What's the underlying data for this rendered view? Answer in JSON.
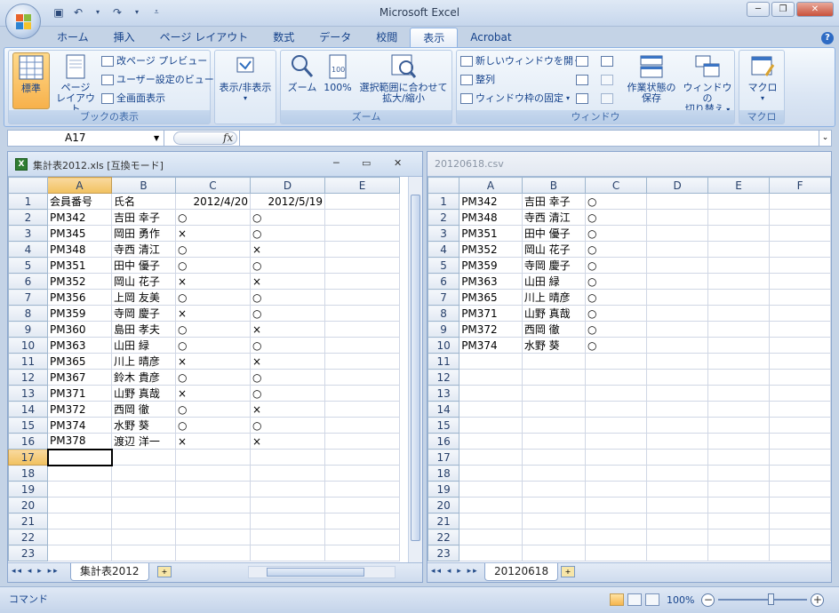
{
  "app": {
    "title": "Microsoft Excel"
  },
  "ribbon": {
    "tabs": [
      "ホーム",
      "挿入",
      "ページ レイアウト",
      "数式",
      "データ",
      "校閲",
      "表示",
      "Acrobat"
    ],
    "active_tab": "表示",
    "groups": {
      "book_view": {
        "label": "ブックの表示",
        "normal": "標準",
        "page_layout_1": "ページ",
        "page_layout_2": "レイアウト",
        "page_break_preview": "改ページ プレビュー",
        "custom_view": "ユーザー設定のビュー",
        "full_screen": "全画面表示"
      },
      "show_hide": {
        "label": "表示/非表示"
      },
      "zoom": {
        "label": "ズーム",
        "zoom": "ズーム",
        "zoom100": "100%",
        "zoom_selection_1": "選択範囲に合わせて",
        "zoom_selection_2": "拡大/縮小"
      },
      "window": {
        "label": "ウィンドウ",
        "new_window": "新しいウィンドウを開く",
        "arrange": "整列",
        "freeze": "ウィンドウ枠の固定",
        "save_workspace_1": "作業状態の",
        "save_workspace_2": "保存",
        "switch_1": "ウィンドウの",
        "switch_2": "切り替え"
      },
      "macro": {
        "label": "マクロ",
        "macro": "マクロ"
      }
    }
  },
  "formula_bar": {
    "name_box": "A17",
    "fx": "fx",
    "formula": ""
  },
  "left_window": {
    "title": "集計表2012.xls  [互換モード]",
    "sheet_tab": "集計表2012",
    "columns": [
      "A",
      "B",
      "C",
      "D",
      "E"
    ],
    "selected_column": "A",
    "selected_row": "17",
    "rows": [
      {
        "n": "1",
        "cells": [
          "会員番号",
          "氏名",
          "2012/4/20",
          "2012/5/19",
          ""
        ]
      },
      {
        "n": "2",
        "cells": [
          "PM342",
          "吉田 幸子",
          "○",
          "○",
          ""
        ]
      },
      {
        "n": "3",
        "cells": [
          "PM345",
          "岡田 勇作",
          "×",
          "○",
          ""
        ]
      },
      {
        "n": "4",
        "cells": [
          "PM348",
          "寺西 清江",
          "○",
          "×",
          ""
        ]
      },
      {
        "n": "5",
        "cells": [
          "PM351",
          "田中 優子",
          "○",
          "○",
          ""
        ]
      },
      {
        "n": "6",
        "cells": [
          "PM352",
          "岡山 花子",
          "×",
          "×",
          ""
        ]
      },
      {
        "n": "7",
        "cells": [
          "PM356",
          "上岡 友美",
          "○",
          "○",
          ""
        ]
      },
      {
        "n": "8",
        "cells": [
          "PM359",
          "寺岡 慶子",
          "×",
          "○",
          ""
        ]
      },
      {
        "n": "9",
        "cells": [
          "PM360",
          "島田 孝夫",
          "○",
          "×",
          ""
        ]
      },
      {
        "n": "10",
        "cells": [
          "PM363",
          "山田 緑",
          "○",
          "○",
          ""
        ]
      },
      {
        "n": "11",
        "cells": [
          "PM365",
          "川上 晴彦",
          "×",
          "×",
          ""
        ]
      },
      {
        "n": "12",
        "cells": [
          "PM367",
          "鈴木 貴彦",
          "○",
          "○",
          ""
        ]
      },
      {
        "n": "13",
        "cells": [
          "PM371",
          "山野 真哉",
          "×",
          "○",
          ""
        ]
      },
      {
        "n": "14",
        "cells": [
          "PM372",
          "西岡 徹",
          "○",
          "×",
          ""
        ]
      },
      {
        "n": "15",
        "cells": [
          "PM374",
          "水野 葵",
          "○",
          "○",
          ""
        ]
      },
      {
        "n": "16",
        "cells": [
          "PM378",
          "渡辺 洋一",
          "×",
          "×",
          ""
        ]
      },
      {
        "n": "17",
        "cells": [
          "",
          "",
          "",
          "",
          ""
        ]
      },
      {
        "n": "18",
        "cells": [
          "",
          "",
          "",
          "",
          ""
        ]
      },
      {
        "n": "19",
        "cells": [
          "",
          "",
          "",
          "",
          ""
        ]
      },
      {
        "n": "20",
        "cells": [
          "",
          "",
          "",
          "",
          ""
        ]
      },
      {
        "n": "21",
        "cells": [
          "",
          "",
          "",
          "",
          ""
        ]
      },
      {
        "n": "22",
        "cells": [
          "",
          "",
          "",
          "",
          ""
        ]
      },
      {
        "n": "23",
        "cells": [
          "",
          "",
          "",
          "",
          ""
        ]
      }
    ]
  },
  "right_window": {
    "title": "20120618.csv",
    "sheet_tab": "20120618",
    "columns": [
      "A",
      "B",
      "C",
      "D",
      "E",
      "F"
    ],
    "rows": [
      {
        "n": "1",
        "cells": [
          "PM342",
          "吉田 幸子",
          "○",
          "",
          "",
          ""
        ]
      },
      {
        "n": "2",
        "cells": [
          "PM348",
          "寺西 清江",
          "○",
          "",
          "",
          ""
        ]
      },
      {
        "n": "3",
        "cells": [
          "PM351",
          "田中 優子",
          "○",
          "",
          "",
          ""
        ]
      },
      {
        "n": "4",
        "cells": [
          "PM352",
          "岡山 花子",
          "○",
          "",
          "",
          ""
        ]
      },
      {
        "n": "5",
        "cells": [
          "PM359",
          "寺岡 慶子",
          "○",
          "",
          "",
          ""
        ]
      },
      {
        "n": "6",
        "cells": [
          "PM363",
          "山田 緑",
          "○",
          "",
          "",
          ""
        ]
      },
      {
        "n": "7",
        "cells": [
          "PM365",
          "川上 晴彦",
          "○",
          "",
          "",
          ""
        ]
      },
      {
        "n": "8",
        "cells": [
          "PM371",
          "山野 真哉",
          "○",
          "",
          "",
          ""
        ]
      },
      {
        "n": "9",
        "cells": [
          "PM372",
          "西岡 徹",
          "○",
          "",
          "",
          ""
        ]
      },
      {
        "n": "10",
        "cells": [
          "PM374",
          "水野 葵",
          "○",
          "",
          "",
          ""
        ]
      },
      {
        "n": "11",
        "cells": [
          "",
          "",
          "",
          "",
          "",
          ""
        ]
      },
      {
        "n": "12",
        "cells": [
          "",
          "",
          "",
          "",
          "",
          ""
        ]
      },
      {
        "n": "13",
        "cells": [
          "",
          "",
          "",
          "",
          "",
          ""
        ]
      },
      {
        "n": "14",
        "cells": [
          "",
          "",
          "",
          "",
          "",
          ""
        ]
      },
      {
        "n": "15",
        "cells": [
          "",
          "",
          "",
          "",
          "",
          ""
        ]
      },
      {
        "n": "16",
        "cells": [
          "",
          "",
          "",
          "",
          "",
          ""
        ]
      },
      {
        "n": "17",
        "cells": [
          "",
          "",
          "",
          "",
          "",
          ""
        ]
      },
      {
        "n": "18",
        "cells": [
          "",
          "",
          "",
          "",
          "",
          ""
        ]
      },
      {
        "n": "19",
        "cells": [
          "",
          "",
          "",
          "",
          "",
          ""
        ]
      },
      {
        "n": "20",
        "cells": [
          "",
          "",
          "",
          "",
          "",
          ""
        ]
      },
      {
        "n": "21",
        "cells": [
          "",
          "",
          "",
          "",
          "",
          ""
        ]
      },
      {
        "n": "22",
        "cells": [
          "",
          "",
          "",
          "",
          "",
          ""
        ]
      },
      {
        "n": "23",
        "cells": [
          "",
          "",
          "",
          "",
          "",
          ""
        ]
      }
    ]
  },
  "status_bar": {
    "mode": "コマンド",
    "zoom": "100%"
  }
}
